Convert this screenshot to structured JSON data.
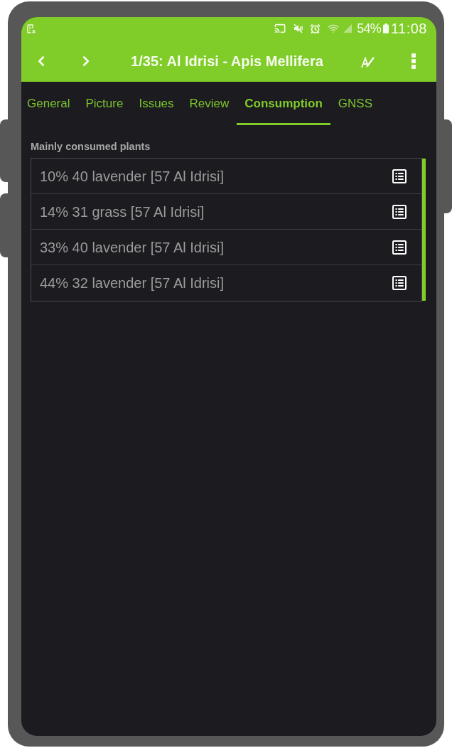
{
  "status_bar": {
    "battery": "54%",
    "time": "11:08"
  },
  "toolbar": {
    "title": "1/35: Al Idrisi - Apis Mellifera"
  },
  "tabs": [
    {
      "label": "General",
      "selected": false
    },
    {
      "label": "Picture",
      "selected": false
    },
    {
      "label": "Issues",
      "selected": false
    },
    {
      "label": "Review",
      "selected": false
    },
    {
      "label": "Consumption",
      "selected": true
    },
    {
      "label": "GNSS",
      "selected": false
    }
  ],
  "section": {
    "label": "Mainly consumed plants",
    "items": [
      {
        "text": "10% 40 lavender [57 Al Idrisi]"
      },
      {
        "text": "14% 31 grass [57 Al Idrisi]"
      },
      {
        "text": "33% 40 lavender [57 Al Idrisi]"
      },
      {
        "text": "44% 32 lavender [57 Al Idrisi]"
      }
    ]
  }
}
